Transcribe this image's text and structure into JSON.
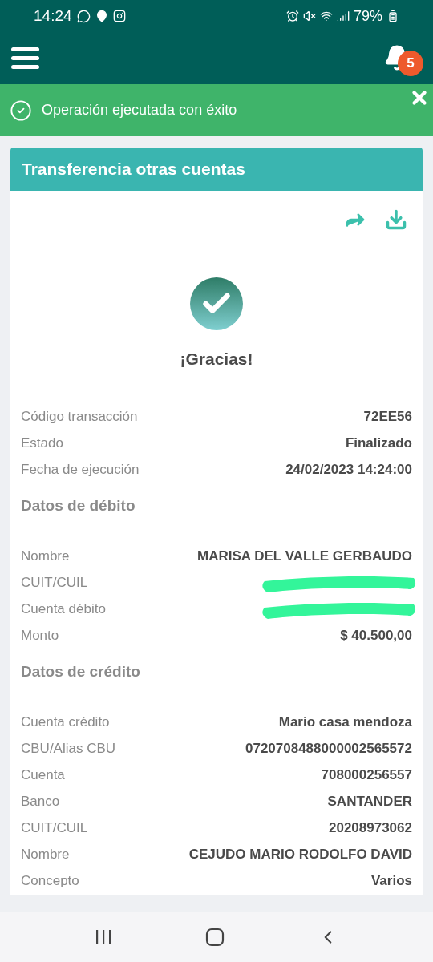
{
  "status_bar": {
    "time": "14:24",
    "battery": "79%"
  },
  "header": {
    "notification_count": "5"
  },
  "banner": {
    "kind": "success",
    "message": "Operación ejecutada con éxito"
  },
  "card": {
    "title": "Transferencia otras cuentas",
    "heading": "¡Gracias!",
    "sections": [
      {
        "rows": [
          {
            "label": "Código transacción",
            "value": "72EE56",
            "redacted": false
          },
          {
            "label": "Estado",
            "value": "Finalizado",
            "redacted": false
          },
          {
            "label": "Fecha de ejecución",
            "value": "24/02/2023 14:24:00",
            "redacted": false
          }
        ]
      },
      {
        "title": "Datos de débito",
        "rows": [
          {
            "label": "Nombre",
            "value": "MARISA DEL VALLE GERBAUDO",
            "redacted": false
          },
          {
            "label": "CUIT/CUIL",
            "redacted": true
          },
          {
            "label": "Cuenta débito",
            "redacted": true
          },
          {
            "label": "Monto",
            "value": "$ 40.500,00",
            "redacted": false
          }
        ]
      },
      {
        "title": "Datos de crédito",
        "rows": [
          {
            "label": "Cuenta crédito",
            "value": "Mario casa mendoza",
            "redacted": false
          },
          {
            "label": "CBU/Alias CBU",
            "value": "0720708488000002565572",
            "redacted": false
          },
          {
            "label": "Cuenta",
            "value": "708000256557",
            "redacted": false
          },
          {
            "label": "Banco",
            "value": "SANTANDER",
            "redacted": false
          },
          {
            "label": "CUIT/CUIL",
            "value": "20208973062",
            "redacted": false
          },
          {
            "label": "Nombre",
            "value": "CEJUDO MARIO RODOLFO DAVID",
            "redacted": false
          },
          {
            "label": "Concepto",
            "value": "Varios",
            "redacted": false
          }
        ]
      }
    ]
  }
}
